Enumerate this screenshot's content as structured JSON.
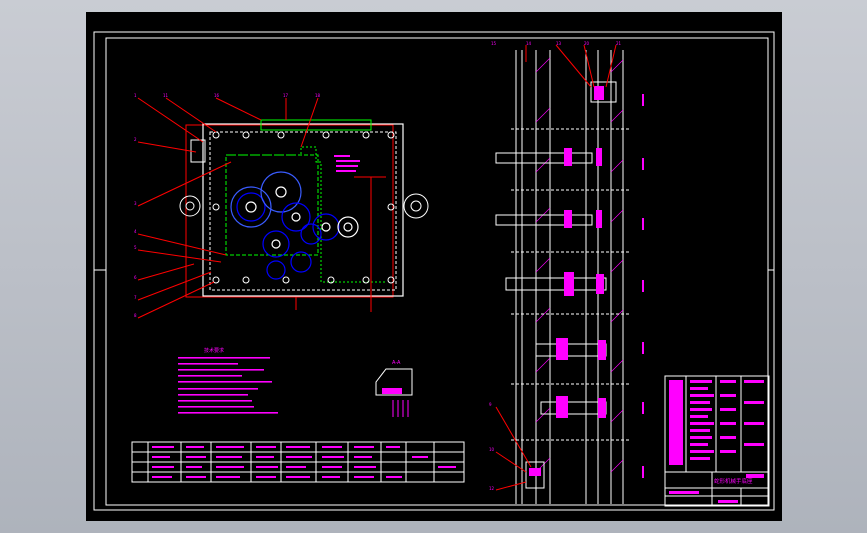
{
  "colors": {
    "background": "#000000",
    "frame": "#ffffff",
    "leaders": "#ff0000",
    "gears": "#0000ff",
    "housing": "#00ff00",
    "text": "#ff00ff",
    "dimension": "#ff0000"
  },
  "drawing": {
    "title_block_text": "蛇形机械手底座",
    "notes_heading": "技术要求",
    "section_label": "A-A"
  }
}
